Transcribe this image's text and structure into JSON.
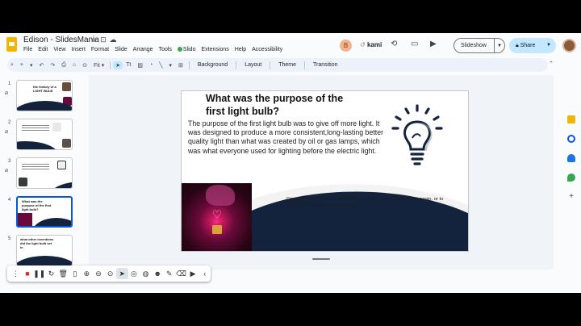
{
  "app": {
    "doc_title": "Edison - SlidesMania",
    "menus": [
      "File",
      "Edit",
      "View",
      "Insert",
      "Format",
      "Slide",
      "Arrange",
      "Tools",
      "Slido",
      "Extensions",
      "Help",
      "Accessibility"
    ],
    "user_initial": "B",
    "kami_label": "kami",
    "slideshow_label": "Slideshow",
    "share_label": "Share"
  },
  "toolbar": {
    "zoom": "Fit",
    "background_label": "Background",
    "layout_label": "Layout",
    "theme_label": "Theme",
    "transition_label": "Transition"
  },
  "filmstrip": {
    "slides": [
      {
        "num": "1",
        "title": "the history of a LIGHT BULB"
      },
      {
        "num": "2",
        "title": ""
      },
      {
        "num": "3",
        "title": ""
      },
      {
        "num": "4",
        "title": "What was the purpose of the first light bulb?"
      },
      {
        "num": "5",
        "title": "what other inventions did the light bulb set in"
      }
    ],
    "selected_index": 4
  },
  "slide": {
    "title": "What was the purpose of the first light bulb?",
    "body": "The purpose of the first light bulb was to give off more light.  It was designed to produce a more consistent,long-lasting better quality light than what was created  by oil or gas lamps, which was what everyone used for lighting before the electric light.",
    "definition_term": "Consistent",
    "definition_rest": " means to do something the same way over and over again, or to behave or happen in a similar way.",
    "colors": {
      "navy": "#13233d",
      "accent": "#0b57d0"
    }
  },
  "annotation_toolbar": {
    "icons": [
      "drag-handle-icon",
      "record-icon",
      "pause-icon",
      "redo-icon",
      "trash-icon",
      "blank-page-icon",
      "zoom-in-icon",
      "zoom-out-icon",
      "zoom-region-icon",
      "pointer-icon",
      "spotlight-icon",
      "camera-icon",
      "emoji-icon",
      "pen-icon",
      "eraser-icon",
      "video-icon",
      "collapse-icon"
    ]
  }
}
